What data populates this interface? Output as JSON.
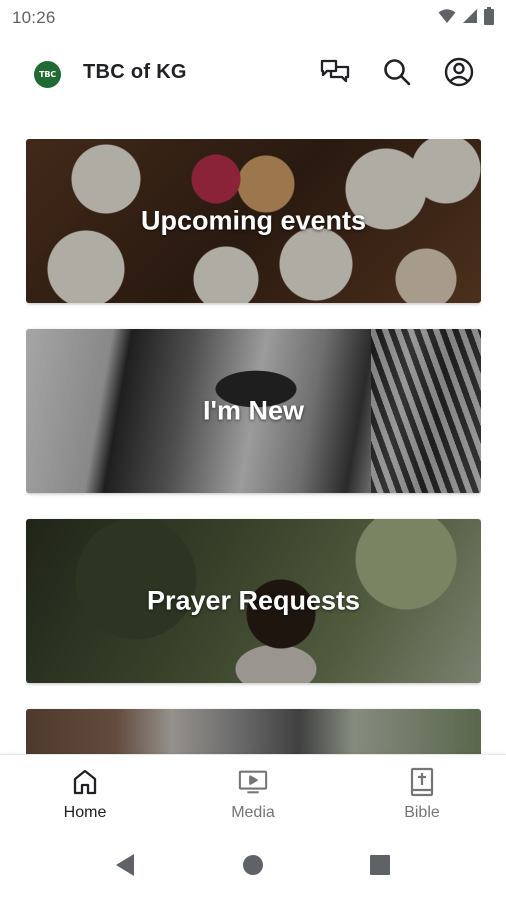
{
  "status_bar": {
    "time": "10:26",
    "icons": [
      "wifi-icon",
      "cell-signal-icon",
      "battery-icon"
    ]
  },
  "app_bar": {
    "logo_text": "TBC",
    "title": "TBC of KG",
    "actions": [
      "chat-icon",
      "search-icon",
      "account-icon"
    ]
  },
  "cards": [
    {
      "label": "Upcoming events"
    },
    {
      "label": "I'm New"
    },
    {
      "label": "Prayer Requests"
    },
    {
      "label": ""
    }
  ],
  "bottom_nav": {
    "items": [
      {
        "label": "Home",
        "icon": "home-icon",
        "active": true
      },
      {
        "label": "Media",
        "icon": "media-icon",
        "active": false
      },
      {
        "label": "Bible",
        "icon": "bible-icon",
        "active": false
      }
    ]
  },
  "system_nav": [
    "back-icon",
    "home-circle-icon",
    "recents-icon"
  ],
  "colors": {
    "logo_green": "#1f6b32",
    "active_nav": "#202124",
    "inactive_nav": "#757575"
  }
}
